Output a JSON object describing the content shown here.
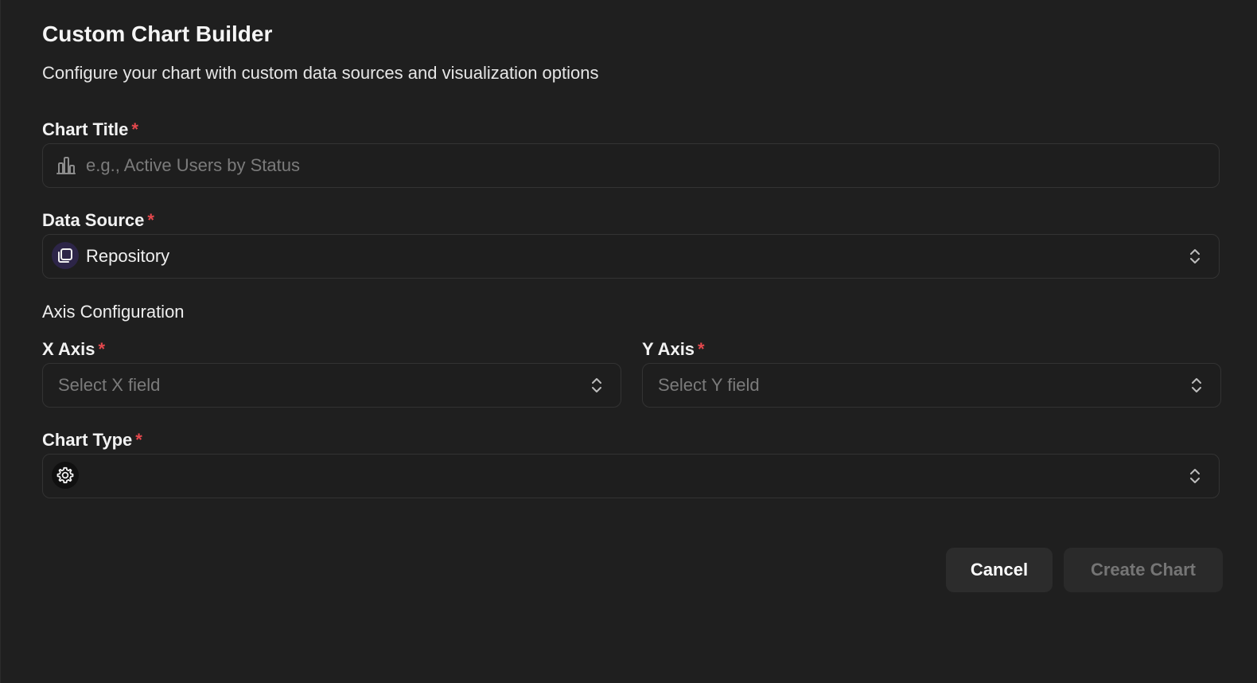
{
  "dialog": {
    "title": "Custom Chart Builder",
    "subtitle": "Configure your chart with custom data sources and visualization options"
  },
  "chart_title": {
    "label": "Chart Title",
    "required_mark": "*",
    "value": "",
    "placeholder": "e.g., Active Users by Status",
    "icon": "bar-chart-icon"
  },
  "data_source": {
    "label": "Data Source",
    "required_mark": "*",
    "selected": "Repository",
    "icon": "repository-icon"
  },
  "axis_config": {
    "section_title": "Axis Configuration",
    "x_axis": {
      "label": "X Axis",
      "required_mark": "*",
      "placeholder": "Select X field"
    },
    "y_axis": {
      "label": "Y Axis",
      "required_mark": "*",
      "placeholder": "Select Y field"
    }
  },
  "chart_type": {
    "label": "Chart Type",
    "required_mark": "*",
    "selected": "",
    "icon": "gear-icon"
  },
  "footer": {
    "cancel_label": "Cancel",
    "create_label": "Create Chart"
  },
  "colors": {
    "background": "#1f1f1f",
    "required": "#e5484d",
    "border": "#333333",
    "repository_badge": "#2d2548"
  }
}
